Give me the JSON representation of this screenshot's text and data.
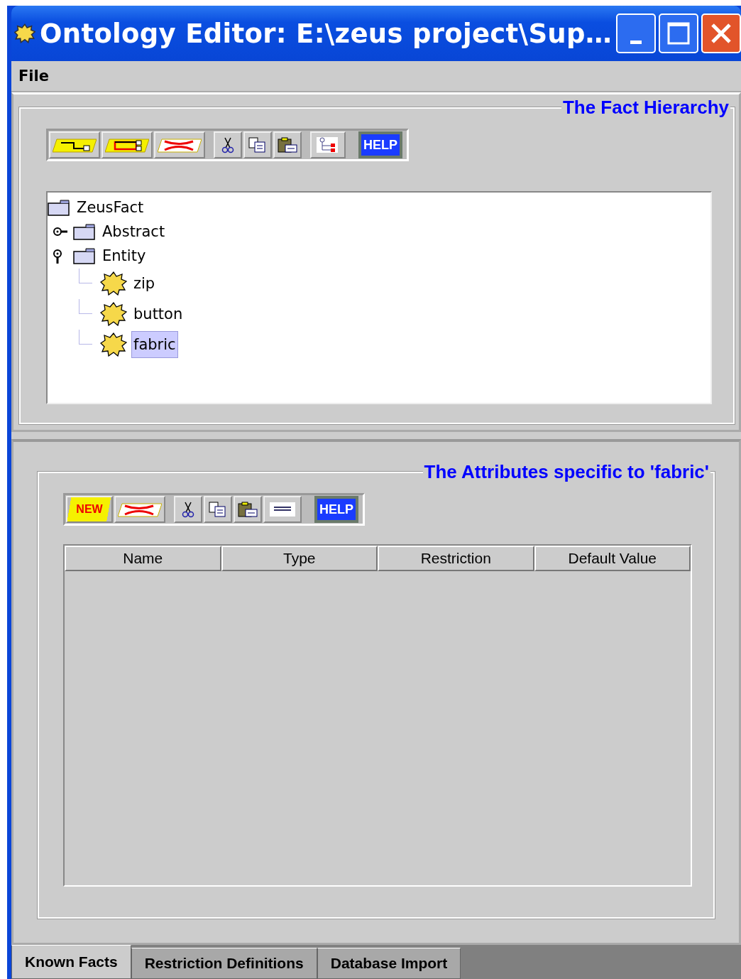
{
  "window": {
    "title": "Ontology Editor: E:\\zeus project\\Sup…"
  },
  "menu": [
    "File"
  ],
  "fact_panel": {
    "title": "The Fact Hierarchy",
    "toolbar": [
      [
        {
          "kind": "add-node"
        },
        {
          "kind": "add-box"
        },
        {
          "kind": "delete"
        }
      ],
      [
        {
          "kind": "cut"
        },
        {
          "kind": "copy"
        },
        {
          "kind": "paste"
        }
      ],
      [
        {
          "kind": "tree"
        }
      ],
      [
        {
          "kind": "help",
          "label": "HELP"
        }
      ]
    ],
    "tree": [
      {
        "label": "ZeusFact",
        "kind": "folder",
        "selected": false,
        "children": [
          {
            "label": "Abstract",
            "kind": "folder",
            "expanded": false,
            "selected": false
          },
          {
            "label": "Entity",
            "kind": "folder",
            "expanded": true,
            "selected": false,
            "children": [
              {
                "label": "zip",
                "kind": "fact",
                "selected": false
              },
              {
                "label": "button",
                "kind": "fact",
                "selected": false
              },
              {
                "label": "fabric",
                "kind": "fact",
                "selected": true
              }
            ]
          }
        ]
      }
    ]
  },
  "attributes_panel": {
    "title": "The Attributes specific to 'fabric'",
    "toolbar": [
      [
        {
          "kind": "new",
          "label": "NEW"
        },
        {
          "kind": "delete"
        }
      ],
      [
        {
          "kind": "cut"
        },
        {
          "kind": "copy"
        },
        {
          "kind": "paste"
        },
        {
          "kind": "line"
        }
      ],
      [
        {
          "kind": "help",
          "label": "HELP"
        }
      ]
    ],
    "table": {
      "columns": [
        "Name",
        "Type",
        "Restriction",
        "Default Value"
      ]
    }
  },
  "tabs": [
    {
      "label": "Known Facts",
      "selected": true
    },
    {
      "label": "Restriction Definitions",
      "selected": false
    },
    {
      "label": "Database Import",
      "selected": false
    }
  ]
}
